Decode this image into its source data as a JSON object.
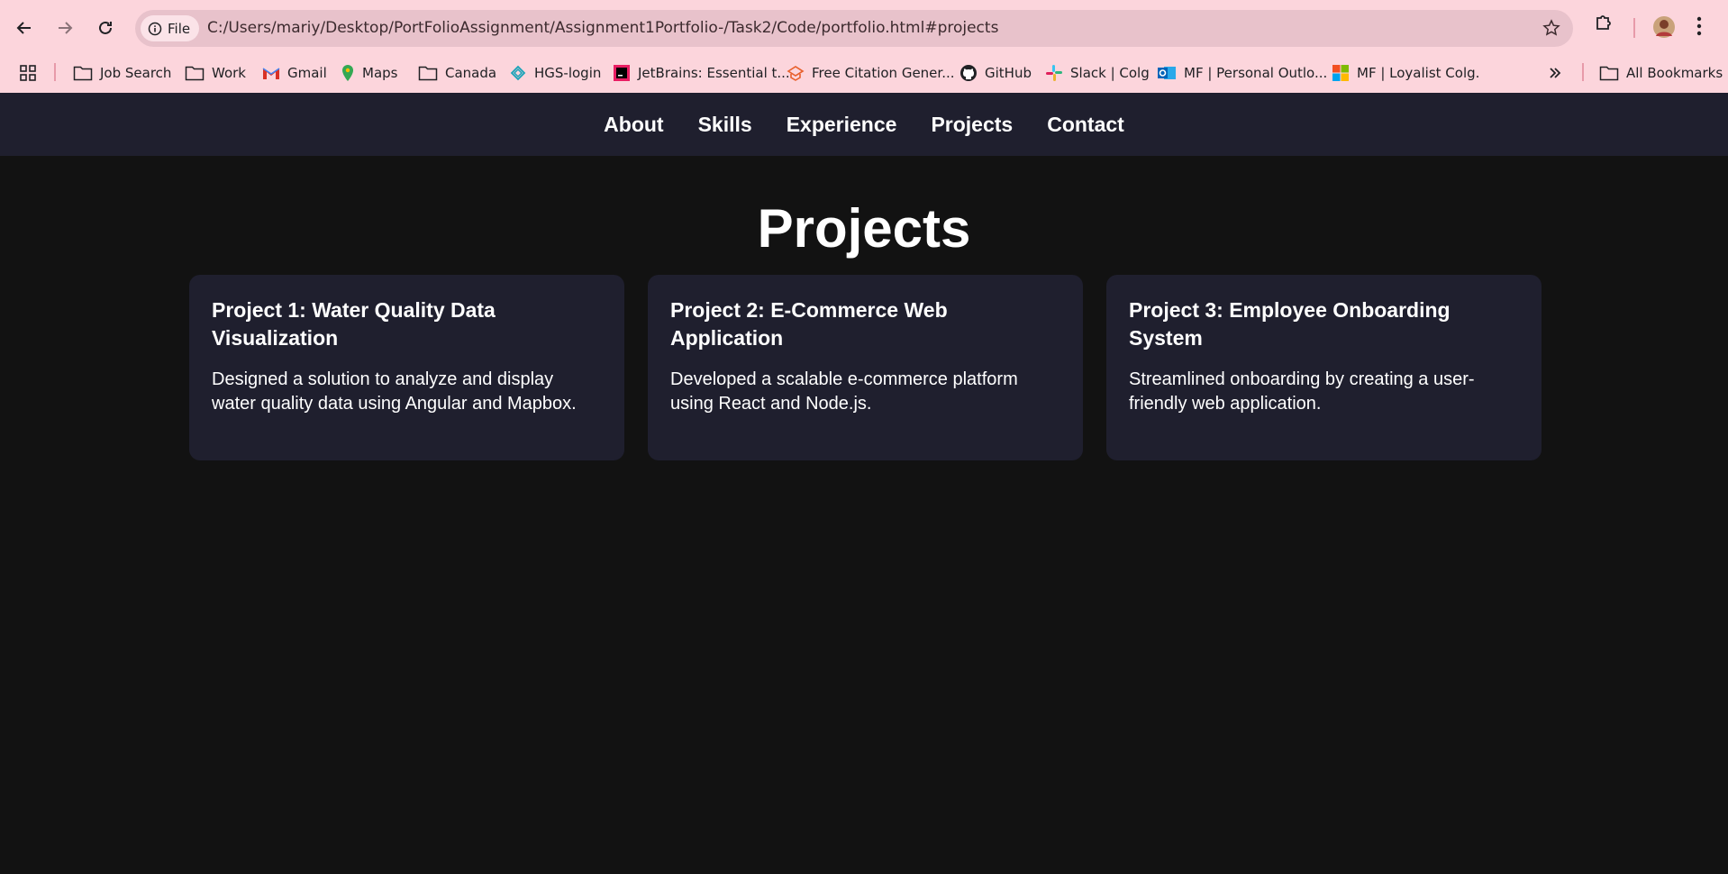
{
  "browser": {
    "site_chip_label": "File",
    "url": "C:/Users/mariy/Desktop/PortFolioAssignment/Assignment1Portfolio-/Task2/Code/portfolio.html#projects",
    "bookmarks": [
      {
        "label": "Job Search",
        "icon": "folder-icon"
      },
      {
        "label": "Work",
        "icon": "folder-icon"
      },
      {
        "label": "Gmail",
        "icon": "gmail-icon"
      },
      {
        "label": "Maps",
        "icon": "maps-icon"
      },
      {
        "label": "Canada",
        "icon": "folder-icon"
      },
      {
        "label": "HGS-login",
        "icon": "hgs-icon"
      },
      {
        "label": "JetBrains: Essential t...",
        "icon": "jetbrains-icon"
      },
      {
        "label": "Free Citation Gener...",
        "icon": "citation-icon"
      },
      {
        "label": "GitHub",
        "icon": "github-icon"
      },
      {
        "label": "Slack | Colg",
        "icon": "slack-icon"
      },
      {
        "label": "MF | Personal Outlo...",
        "icon": "outlook-icon"
      },
      {
        "label": "MF | Loyalist Colg.",
        "icon": "microsoft-icon"
      }
    ],
    "all_bookmarks_label": "All Bookmarks",
    "accent_color": "#fcd5dc"
  },
  "site": {
    "nav": [
      "About",
      "Skills",
      "Experience",
      "Projects",
      "Contact"
    ],
    "section_title": "Projects",
    "projects": [
      {
        "title": "Project 1: Water Quality Data Visualization",
        "description": "Designed a solution to analyze and display water quality data using Angular and Mapbox."
      },
      {
        "title": "Project 2: E-Commerce Web Application",
        "description": "Developed a scalable e-commerce platform using React and Node.js."
      },
      {
        "title": "Project 3: Employee Onboarding System",
        "description": "Streamlined onboarding by creating a user-friendly web application."
      }
    ],
    "background_color": "#121212",
    "card_color": "#1f1f2e"
  }
}
